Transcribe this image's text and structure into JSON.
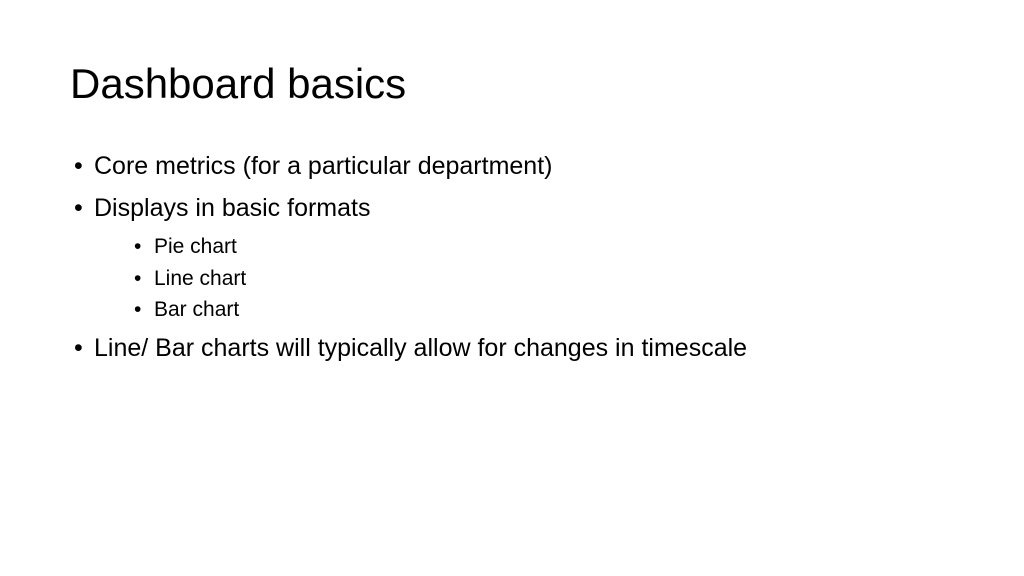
{
  "slide": {
    "title": "Dashboard basics",
    "bullets": [
      {
        "text": "Core metrics (for a particular department)"
      },
      {
        "text": "Displays in basic formats",
        "sub": [
          "Pie chart",
          "Line chart",
          "Bar chart"
        ]
      },
      {
        "text": "Line/ Bar charts will typically allow for changes in timescale"
      }
    ]
  }
}
